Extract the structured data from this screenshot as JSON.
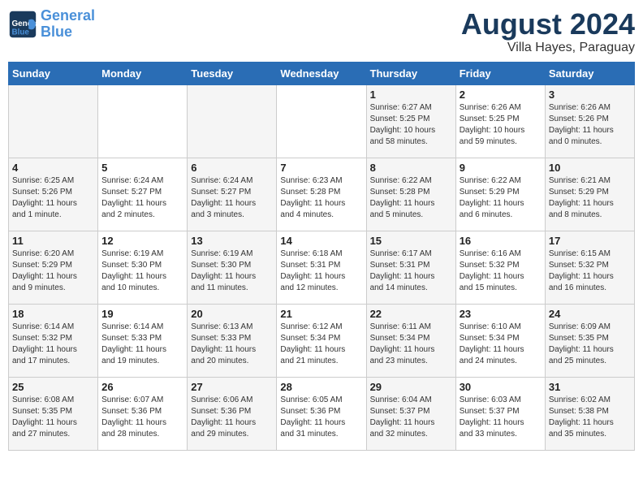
{
  "header": {
    "logo_general": "General",
    "logo_blue": "Blue",
    "month_title": "August 2024",
    "location": "Villa Hayes, Paraguay"
  },
  "days_of_week": [
    "Sunday",
    "Monday",
    "Tuesday",
    "Wednesday",
    "Thursday",
    "Friday",
    "Saturday"
  ],
  "weeks": [
    [
      {
        "day": "",
        "info": ""
      },
      {
        "day": "",
        "info": ""
      },
      {
        "day": "",
        "info": ""
      },
      {
        "day": "",
        "info": ""
      },
      {
        "day": "1",
        "info": "Sunrise: 6:27 AM\nSunset: 5:25 PM\nDaylight: 10 hours\nand 58 minutes."
      },
      {
        "day": "2",
        "info": "Sunrise: 6:26 AM\nSunset: 5:25 PM\nDaylight: 10 hours\nand 59 minutes."
      },
      {
        "day": "3",
        "info": "Sunrise: 6:26 AM\nSunset: 5:26 PM\nDaylight: 11 hours\nand 0 minutes."
      }
    ],
    [
      {
        "day": "4",
        "info": "Sunrise: 6:25 AM\nSunset: 5:26 PM\nDaylight: 11 hours\nand 1 minute."
      },
      {
        "day": "5",
        "info": "Sunrise: 6:24 AM\nSunset: 5:27 PM\nDaylight: 11 hours\nand 2 minutes."
      },
      {
        "day": "6",
        "info": "Sunrise: 6:24 AM\nSunset: 5:27 PM\nDaylight: 11 hours\nand 3 minutes."
      },
      {
        "day": "7",
        "info": "Sunrise: 6:23 AM\nSunset: 5:28 PM\nDaylight: 11 hours\nand 4 minutes."
      },
      {
        "day": "8",
        "info": "Sunrise: 6:22 AM\nSunset: 5:28 PM\nDaylight: 11 hours\nand 5 minutes."
      },
      {
        "day": "9",
        "info": "Sunrise: 6:22 AM\nSunset: 5:29 PM\nDaylight: 11 hours\nand 6 minutes."
      },
      {
        "day": "10",
        "info": "Sunrise: 6:21 AM\nSunset: 5:29 PM\nDaylight: 11 hours\nand 8 minutes."
      }
    ],
    [
      {
        "day": "11",
        "info": "Sunrise: 6:20 AM\nSunset: 5:29 PM\nDaylight: 11 hours\nand 9 minutes."
      },
      {
        "day": "12",
        "info": "Sunrise: 6:19 AM\nSunset: 5:30 PM\nDaylight: 11 hours\nand 10 minutes."
      },
      {
        "day": "13",
        "info": "Sunrise: 6:19 AM\nSunset: 5:30 PM\nDaylight: 11 hours\nand 11 minutes."
      },
      {
        "day": "14",
        "info": "Sunrise: 6:18 AM\nSunset: 5:31 PM\nDaylight: 11 hours\nand 12 minutes."
      },
      {
        "day": "15",
        "info": "Sunrise: 6:17 AM\nSunset: 5:31 PM\nDaylight: 11 hours\nand 14 minutes."
      },
      {
        "day": "16",
        "info": "Sunrise: 6:16 AM\nSunset: 5:32 PM\nDaylight: 11 hours\nand 15 minutes."
      },
      {
        "day": "17",
        "info": "Sunrise: 6:15 AM\nSunset: 5:32 PM\nDaylight: 11 hours\nand 16 minutes."
      }
    ],
    [
      {
        "day": "18",
        "info": "Sunrise: 6:14 AM\nSunset: 5:32 PM\nDaylight: 11 hours\nand 17 minutes."
      },
      {
        "day": "19",
        "info": "Sunrise: 6:14 AM\nSunset: 5:33 PM\nDaylight: 11 hours\nand 19 minutes."
      },
      {
        "day": "20",
        "info": "Sunrise: 6:13 AM\nSunset: 5:33 PM\nDaylight: 11 hours\nand 20 minutes."
      },
      {
        "day": "21",
        "info": "Sunrise: 6:12 AM\nSunset: 5:34 PM\nDaylight: 11 hours\nand 21 minutes."
      },
      {
        "day": "22",
        "info": "Sunrise: 6:11 AM\nSunset: 5:34 PM\nDaylight: 11 hours\nand 23 minutes."
      },
      {
        "day": "23",
        "info": "Sunrise: 6:10 AM\nSunset: 5:34 PM\nDaylight: 11 hours\nand 24 minutes."
      },
      {
        "day": "24",
        "info": "Sunrise: 6:09 AM\nSunset: 5:35 PM\nDaylight: 11 hours\nand 25 minutes."
      }
    ],
    [
      {
        "day": "25",
        "info": "Sunrise: 6:08 AM\nSunset: 5:35 PM\nDaylight: 11 hours\nand 27 minutes."
      },
      {
        "day": "26",
        "info": "Sunrise: 6:07 AM\nSunset: 5:36 PM\nDaylight: 11 hours\nand 28 minutes."
      },
      {
        "day": "27",
        "info": "Sunrise: 6:06 AM\nSunset: 5:36 PM\nDaylight: 11 hours\nand 29 minutes."
      },
      {
        "day": "28",
        "info": "Sunrise: 6:05 AM\nSunset: 5:36 PM\nDaylight: 11 hours\nand 31 minutes."
      },
      {
        "day": "29",
        "info": "Sunrise: 6:04 AM\nSunset: 5:37 PM\nDaylight: 11 hours\nand 32 minutes."
      },
      {
        "day": "30",
        "info": "Sunrise: 6:03 AM\nSunset: 5:37 PM\nDaylight: 11 hours\nand 33 minutes."
      },
      {
        "day": "31",
        "info": "Sunrise: 6:02 AM\nSunset: 5:38 PM\nDaylight: 11 hours\nand 35 minutes."
      }
    ]
  ]
}
